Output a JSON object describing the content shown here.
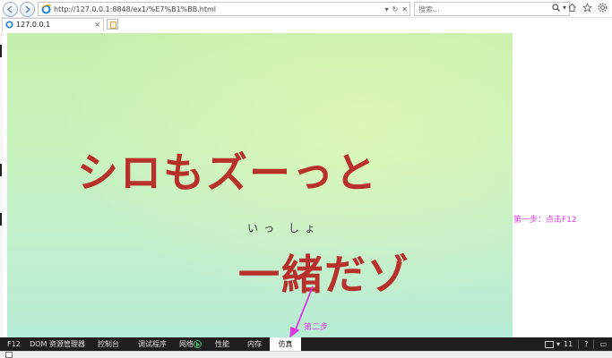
{
  "browser": {
    "url": "http://127.0.0.1:8848/ex1/%E7%B1%BB.html",
    "search_placeholder": "搜索...",
    "tab_title": "127.0.0.1",
    "tab_close": "×"
  },
  "video": {
    "caption_line1": "シロもズーっと",
    "caption_furigana": "いっ しょ",
    "caption_line2": "一緒だゾ"
  },
  "annotations": {
    "step1": "第一步：点击F12",
    "step2": "第二步",
    "arrow_color": "#d93ad9"
  },
  "devtools": {
    "tabs": [
      {
        "label": "F12"
      },
      {
        "label": "DOM 资源管理器"
      },
      {
        "label": "控制台"
      },
      {
        "label": "调试程序"
      },
      {
        "label": "网络"
      },
      {
        "label": "性能"
      },
      {
        "label": "内存"
      },
      {
        "label": "仿真"
      }
    ],
    "active_tab": "仿真",
    "device_count": "11",
    "help_label": "?"
  },
  "colors": {
    "caption_red": "#b8302b",
    "annotation_magenta": "#e040e0",
    "devtools_bg": "#1e1e1e"
  },
  "icons": [
    "back-icon",
    "forward-icon",
    "ie-logo-icon",
    "refresh-icon",
    "search-icon",
    "home-icon",
    "star-icon",
    "gear-icon",
    "play-icon",
    "monitor-icon"
  ]
}
